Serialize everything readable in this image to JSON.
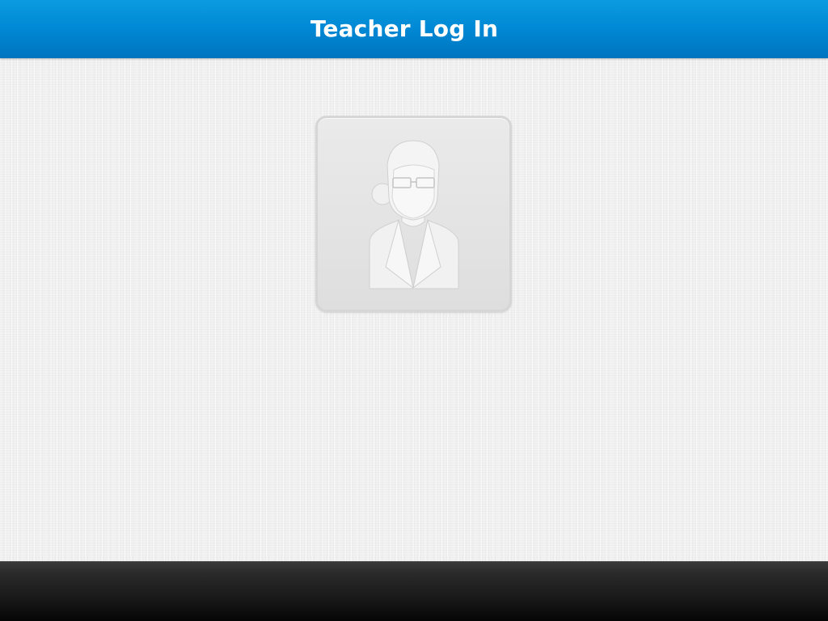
{
  "header": {
    "title": "Teacher Log In"
  },
  "teacher_tile": {
    "icon": "teacher-avatar-icon"
  },
  "colors": {
    "header_blue": "#0088d4",
    "background": "#f2f2f2",
    "footer": "#151515"
  }
}
